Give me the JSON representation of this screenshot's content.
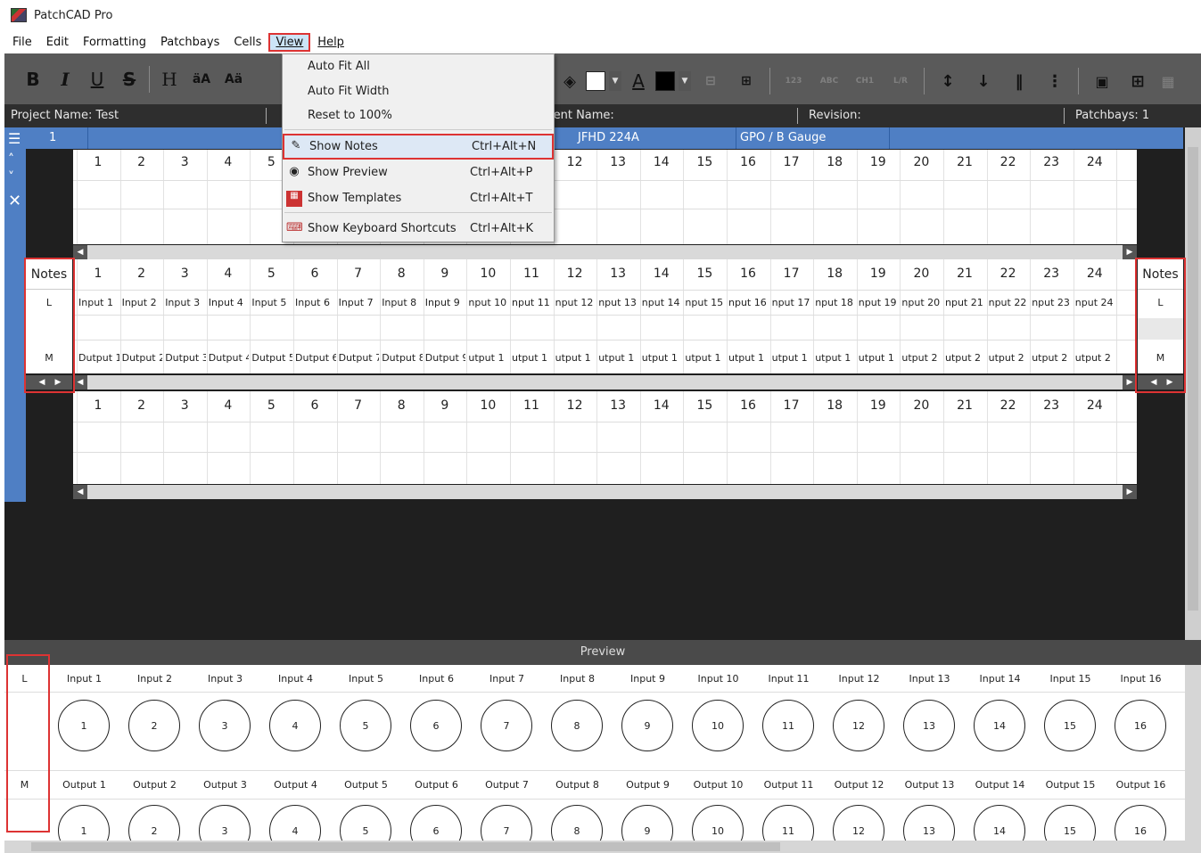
{
  "app": {
    "title": "PatchCAD Pro"
  },
  "menu": [
    "File",
    "Edit",
    "Formatting",
    "Patchbays",
    "Cells",
    "View",
    "Help"
  ],
  "toolbar": {
    "bold": "B",
    "italic": "I",
    "underline": "U",
    "strike": "S",
    "heading": "H",
    "case1": "äA",
    "case2": "Aä",
    "fill_color": "#ffffff",
    "font_color": "#000000"
  },
  "info": {
    "project": "Project Name: Test",
    "client": "ient Name:",
    "revision": "Revision:",
    "patchbays": "Patchbays: 1"
  },
  "patchbay_header": {
    "index": "1",
    "model": "JFHD 224A",
    "gauge": "GPO / B Gauge"
  },
  "view_menu": [
    {
      "label": "Auto Fit All",
      "shortcut": "",
      "icon": ""
    },
    {
      "label": "Auto Fit Width",
      "shortcut": "",
      "icon": ""
    },
    {
      "label": "Reset to 100%",
      "shortcut": "",
      "icon": ""
    },
    {
      "label": "Show Notes",
      "shortcut": "Ctrl+Alt+N",
      "icon": "notes-icon"
    },
    {
      "label": "Show Preview",
      "shortcut": "Ctrl+Alt+P",
      "icon": "eye-icon"
    },
    {
      "label": "Show Templates",
      "shortcut": "Ctrl+Alt+T",
      "icon": "templates-icon"
    },
    {
      "label": "Show Keyboard Shortcuts",
      "shortcut": "Ctrl+Alt+K",
      "icon": "keyboard-icon"
    }
  ],
  "columns": [
    "1",
    "2",
    "3",
    "4",
    "5",
    "6",
    "7",
    "8",
    "9",
    "10",
    "11",
    "12",
    "13",
    "14",
    "15",
    "16",
    "17",
    "18",
    "19",
    "20",
    "21",
    "22",
    "23",
    "24"
  ],
  "inputs": [
    "Input 1",
    "Input 2",
    "Input 3",
    "Input 4",
    "Input 5",
    "Input 6",
    "Input 7",
    "Input 8",
    "Input 9",
    "nput 10",
    "nput 11",
    "nput 12",
    "nput 13",
    "nput 14",
    "nput 15",
    "nput 16",
    "nput 17",
    "nput 18",
    "nput 19",
    "nput 20",
    "nput 21",
    "nput 22",
    "nput 23",
    "nput 24"
  ],
  "outputs": [
    "Dutput 1",
    "Dutput 2",
    "Dutput 3",
    "Dutput 4",
    "Dutput 5",
    "Dutput 6",
    "Dutput 7",
    "Dutput 8",
    "Dutput 9",
    "utput 1",
    "utput 1",
    "utput 1",
    "utput 1",
    "utput 1",
    "utput 1",
    "utput 1",
    "utput 1",
    "utput 1",
    "utput 1",
    "utput 2",
    "utput 2",
    "utput 2",
    "utput 2",
    "utput 2"
  ],
  "notes": {
    "header": "Notes",
    "row1": "L",
    "row2": "M"
  },
  "preview": {
    "title": "Preview",
    "row1": "L",
    "row2": "M",
    "inputs": [
      "Input 1",
      "Input 2",
      "Input 3",
      "Input 4",
      "Input 5",
      "Input 6",
      "Input 7",
      "Input 8",
      "Input 9",
      "Input 10",
      "Input 11",
      "Input 12",
      "Input 13",
      "Input 14",
      "Input 15",
      "Input 16"
    ],
    "outputs": [
      "Output 1",
      "Output 2",
      "Output 3",
      "Output 4",
      "Output 5",
      "Output 6",
      "Output 7",
      "Output 8",
      "Output 9",
      "Output 10",
      "Output 11",
      "Output 12",
      "Output 13",
      "Output 14",
      "Output 15",
      "Output 16"
    ],
    "jacks": [
      "1",
      "2",
      "3",
      "4",
      "5",
      "6",
      "7",
      "8",
      "9",
      "10",
      "11",
      "12",
      "13",
      "14",
      "15",
      "16"
    ]
  }
}
